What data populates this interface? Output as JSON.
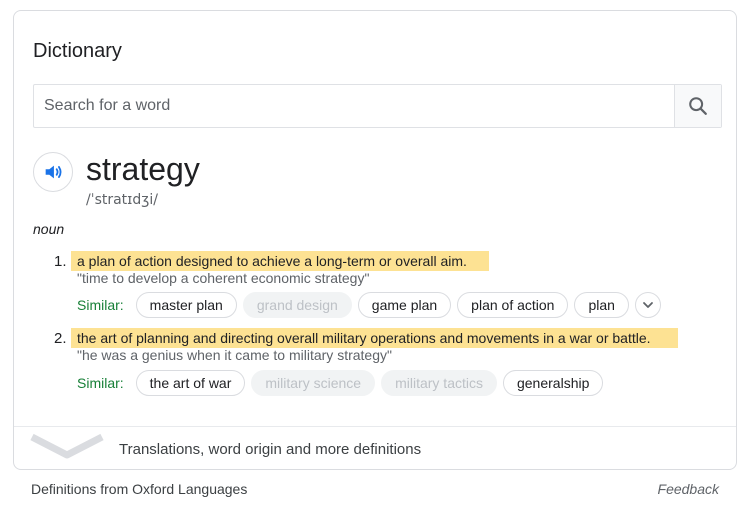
{
  "card": {
    "title": "Dictionary",
    "search": {
      "placeholder": "Search for a word",
      "button_icon": "search-icon"
    },
    "entry": {
      "speaker_icon": "speaker-icon",
      "word": "strategy",
      "phonetic": "/ˈstratɪdʒi/",
      "part_of_speech": "noun",
      "definitions": [
        {
          "number": "1.",
          "text": "a plan of action designed to achieve a long-term or overall aim.",
          "example": "\"time to develop a coherent economic strategy\"",
          "similar_label": "Similar:",
          "similar": [
            "master plan",
            "grand design",
            "game plan",
            "plan of action",
            "plan"
          ],
          "more_icon": "chevron-down-icon"
        },
        {
          "number": "2.",
          "text": "the art of planning and directing overall military operations and movements in a war or battle.",
          "example": "\"he was a genius when it came to military strategy\"",
          "similar_label": "Similar:",
          "similar": [
            "the art of war",
            "military science",
            "military tactics",
            "generalship"
          ]
        }
      ]
    },
    "more": {
      "icon": "expand-chevron-icon",
      "text": "Translations, word origin and more definitions"
    }
  },
  "footer": {
    "source": "Definitions from Oxford Languages",
    "feedback": "Feedback"
  },
  "colors": {
    "highlight": "#fde293",
    "similar_label": "#188038",
    "speaker_blue": "#1a73e8",
    "dim_chip_text": "#bdc1c6"
  }
}
